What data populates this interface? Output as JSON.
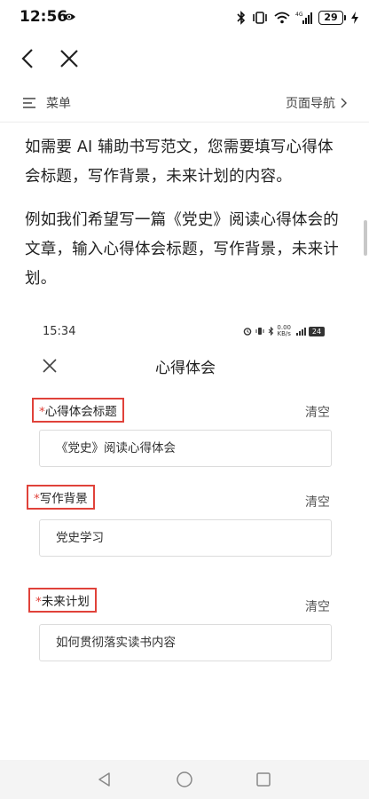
{
  "status_bar": {
    "time": "12:56",
    "battery": "29"
  },
  "menu_bar": {
    "menu_label": "菜单",
    "page_nav_label": "页面导航"
  },
  "article": {
    "paragraphs": [
      "如需要 AI 辅助书写范文，您需要填写心得体会标题，写作背景，未来计划的内容。",
      "例如我们希望写一篇《党史》阅读心得体会的文章，输入心得体会标题，写作背景，未来计划。"
    ]
  },
  "embedded_screen": {
    "time": "15:34",
    "net_speed_top": "0.00",
    "net_speed_bottom": "KB/s",
    "battery": "24",
    "title": "心得体会",
    "fields": [
      {
        "required_mark": "*",
        "label": "心得体会标题",
        "clear_label": "清空",
        "value": "《党史》阅读心得体会"
      },
      {
        "required_mark": "*",
        "label": "写作背景",
        "clear_label": "清空",
        "value": "党史学习"
      },
      {
        "required_mark": "*",
        "label": "未来计划",
        "clear_label": "清空",
        "value": "如何贯彻落实读书内容"
      }
    ]
  },
  "icons": {
    "eye": "eye-icon",
    "bluetooth": "bluetooth-icon",
    "vibrate": "vibrate-icon",
    "wifi": "wifi-icon",
    "signal": "signal-icon",
    "charging": "charging-icon",
    "back": "back-arrow-icon",
    "close": "close-icon",
    "menu": "menu-icon",
    "chevron": "chevron-right-icon"
  },
  "colors": {
    "highlight_border": "#e0423a",
    "text": "#222222",
    "nav_bar_bg": "#f4f4f4"
  }
}
